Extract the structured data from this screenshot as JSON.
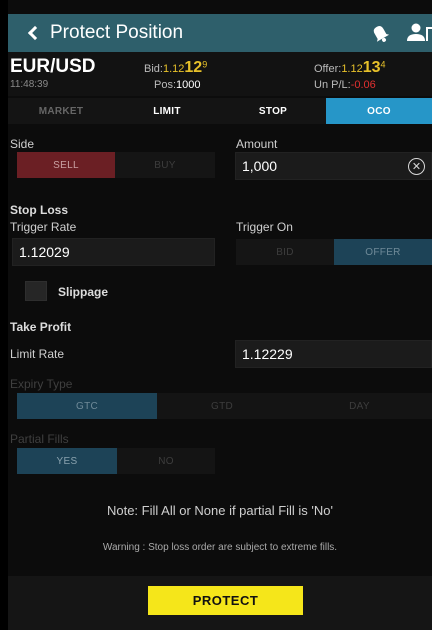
{
  "header": {
    "title": "Protect Position",
    "icons": [
      "back-chevron-icon",
      "bell-icon",
      "user-icon"
    ]
  },
  "quote": {
    "symbol": "EUR/USD",
    "time": "11:48:39",
    "bid_label": "Bid:",
    "bid_prefix": "1.12",
    "bid_big": "12",
    "bid_sup": "9",
    "pos_label": "Pos:",
    "pos_value": "1000",
    "offer_label": "Offer:",
    "offer_prefix": "1.12",
    "offer_big": "13",
    "offer_sup": "4",
    "upl_label": "Un P/L:",
    "upl_value": "-0.06"
  },
  "tabs": [
    {
      "label": "MARKET"
    },
    {
      "label": "LIMIT"
    },
    {
      "label": "STOP"
    },
    {
      "label": "OCO"
    }
  ],
  "active_tab": "OCO",
  "side": {
    "label": "Side",
    "options": [
      "SELL",
      "BUY"
    ],
    "selected": "SELL"
  },
  "amount": {
    "label": "Amount",
    "value": "1,000"
  },
  "stop_loss": {
    "heading": "Stop Loss",
    "trigger_rate_label": "Trigger Rate",
    "trigger_rate_value": "1.12029",
    "trigger_on_label": "Trigger On",
    "trigger_on_options": [
      "BID",
      "OFFER"
    ],
    "trigger_on_selected": "OFFER",
    "slippage_label": "Slippage"
  },
  "take_profit": {
    "heading": "Take Profit",
    "limit_rate_label": "Limit Rate",
    "limit_rate_value": "1.12229"
  },
  "expiry": {
    "label": "Expiry Type",
    "options": [
      "GTC",
      "GTD",
      "DAY"
    ],
    "selected": "GTC"
  },
  "partial_fills": {
    "label": "Partial Fills",
    "options": [
      "YES",
      "NO"
    ],
    "selected": "YES"
  },
  "note": "Note: Fill All or None if partial Fill is 'No'",
  "warning": "Warning : Stop loss order are subject to extreme fills.",
  "protect_label": "PROTECT",
  "colors": {
    "header": "#2e5f6b",
    "active_tab": "#2696c8",
    "sell_selected": "#6b1f24",
    "toggle_selected": "#1d4357",
    "rate_yellow": "#e7c12a",
    "loss_red": "#e03030",
    "protect_button": "#f5e61a"
  }
}
